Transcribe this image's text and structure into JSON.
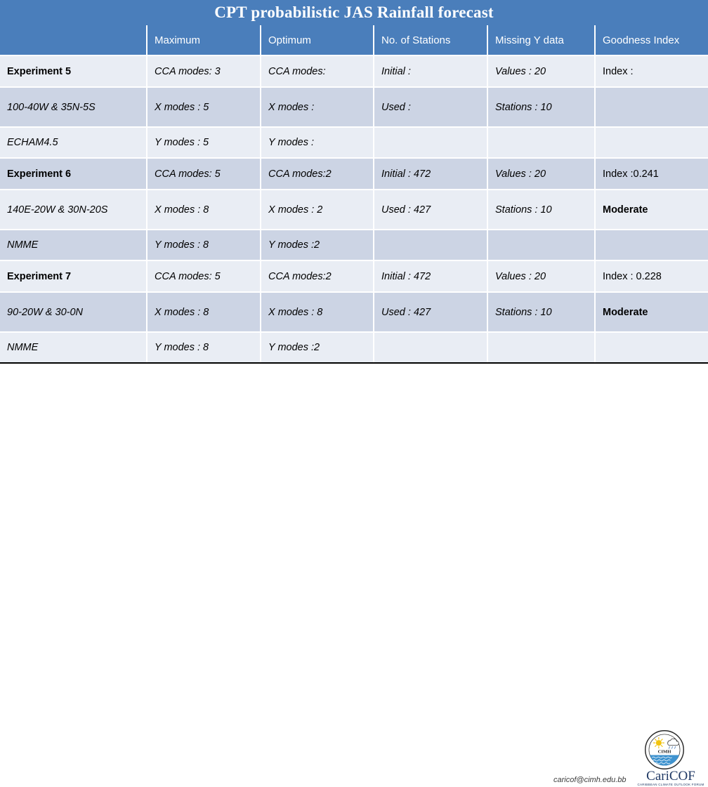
{
  "title": "CPT probabilistic JAS Rainfall forecast",
  "accent_color": "#4a7ebb",
  "band_light_color": "#e9edf4",
  "band_dark_color": "#ccd4e4",
  "table": {
    "headers": [
      "",
      "Maximum",
      "Optimum",
      "No. of Stations",
      "Missing Y data",
      "Goodness Index"
    ],
    "groups": [
      {
        "rows": [
          [
            "Experiment 5",
            "CCA modes: 3",
            "CCA modes:",
            "Initial :",
            "Values : 20",
            "Index :"
          ],
          [
            "100-40W & 35N-5S",
            "X modes : 5",
            "X modes :",
            "Used :",
            "Stations : 10",
            ""
          ],
          [
            "ECHAM4.5",
            "Y modes : 5",
            "Y modes :",
            "",
            "",
            ""
          ]
        ]
      },
      {
        "rows": [
          [
            "Experiment 6",
            "CCA modes: 5",
            "CCA modes:2",
            "Initial : 472",
            "Values : 20",
            "Index :0.241"
          ],
          [
            "140E-20W & 30N-20S",
            "X modes : 8",
            "X modes : 2",
            "Used : 427",
            "Stations : 10",
            "Moderate"
          ],
          [
            "NMME",
            "Y modes : 8",
            "Y modes :2",
            "",
            "",
            ""
          ]
        ]
      },
      {
        "rows": [
          [
            "Experiment 7",
            "CCA modes: 5",
            "CCA modes:2",
            "Initial : 472",
            "Values : 20",
            "Index : 0.228"
          ],
          [
            "90-20W & 30-0N",
            "X modes : 8",
            "X modes : 8",
            "Used : 427",
            "Stations : 10",
            "Moderate"
          ],
          [
            "NMME",
            "Y modes : 8",
            "Y modes :2",
            "",
            "",
            ""
          ]
        ]
      }
    ]
  },
  "footer": {
    "email": "caricof@cimh.edu.bb",
    "cimh_label": "CIMH",
    "caricof_word": "CariCOF",
    "caricof_sub": "CARIBBEAN CLIMATE OUTLOOK FORUM"
  }
}
